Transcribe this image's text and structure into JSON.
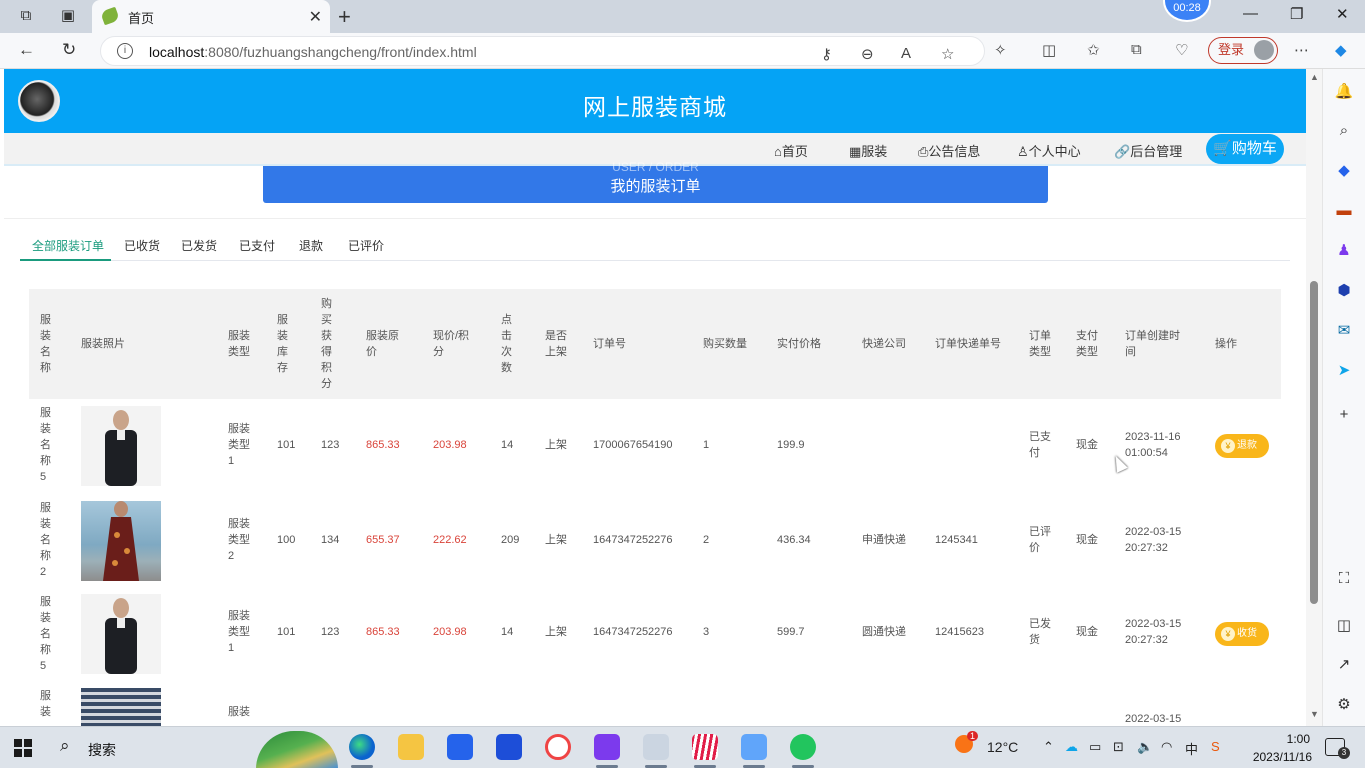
{
  "browser": {
    "tab_title": "首页",
    "clock_bubble": "00:28",
    "url_host": "localhost",
    "url_path": ":8080/fuzhuangshangcheng/front/index.html",
    "login_label": "登录"
  },
  "site": {
    "title": "网上服装商城",
    "nav": [
      {
        "label": "首页",
        "icon": "⌂"
      },
      {
        "label": "服装",
        "icon": "▦"
      },
      {
        "label": "公告信息",
        "icon": "⎙"
      },
      {
        "label": "个人中心",
        "icon": "♙"
      },
      {
        "label": "后台管理",
        "icon": "🔗"
      }
    ],
    "cart_label": "购物车",
    "cart_icon": "🛒",
    "banner_ghost": "USER / ORDER",
    "banner_title": "我的服装订单"
  },
  "order_tabs": [
    "全部服装订单",
    "已收货",
    "已发货",
    "已支付",
    "退款",
    "已评价"
  ],
  "table": {
    "headers": [
      "服装名称",
      "服装照片",
      "服装类型",
      "服装库存",
      "购买获得积分",
      "服装原价",
      "现价/积分",
      "点击次数",
      "是否上架",
      "订单号",
      "购买数量",
      "实付价格",
      "快递公司",
      "订单快递单号",
      "订单类型",
      "支付类型",
      "订单创建时间",
      "操作"
    ],
    "rows": [
      {
        "name": "服装名称5",
        "img": "suit",
        "type": "服装类型1",
        "stock": "101",
        "points": "123",
        "orig": "865.33",
        "now": "203.98",
        "clicks": "14",
        "shelf": "上架",
        "order_no": "1700067654190",
        "qty": "1",
        "paid": "199.9",
        "express": "",
        "express_no": "",
        "status": "已支付",
        "pay": "现金",
        "created_date": "2023-11-16",
        "created_time": "01:00:54",
        "action": "退款"
      },
      {
        "name": "服装名称2",
        "img": "dress",
        "type": "服装类型2",
        "stock": "100",
        "points": "134",
        "orig": "655.37",
        "now": "222.62",
        "clicks": "209",
        "shelf": "上架",
        "order_no": "1647347252276",
        "qty": "2",
        "paid": "436.34",
        "express": "申通快递",
        "express_no": "1245341",
        "status": "已评价",
        "pay": "现金",
        "created_date": "2022-03-15",
        "created_time": "20:27:32",
        "action": ""
      },
      {
        "name": "服装名称5",
        "img": "suit",
        "type": "服装类型1",
        "stock": "101",
        "points": "123",
        "orig": "865.33",
        "now": "203.98",
        "clicks": "14",
        "shelf": "上架",
        "order_no": "1647347252276",
        "qty": "3",
        "paid": "599.7",
        "express": "圆通快递",
        "express_no": "12415623",
        "status": "已发货",
        "pay": "现金",
        "created_date": "2022-03-15",
        "created_time": "20:27:32",
        "action": "收货"
      },
      {
        "name": "服装",
        "img": "stripe",
        "type": "服装",
        "stock": "",
        "points": "",
        "orig": "",
        "now": "",
        "clicks": "",
        "shelf": "",
        "order_no": "",
        "qty": "",
        "paid": "",
        "express": "",
        "express_no": "",
        "status": "",
        "pay": "",
        "created_date": "2022-03-15",
        "created_time": "",
        "action": ""
      }
    ]
  },
  "taskbar": {
    "search_label": "搜索",
    "weather": "12°C",
    "weather_badge": "1",
    "ime": "中",
    "time": "1:00",
    "date": "2023/11/16",
    "notif_count": "3"
  }
}
